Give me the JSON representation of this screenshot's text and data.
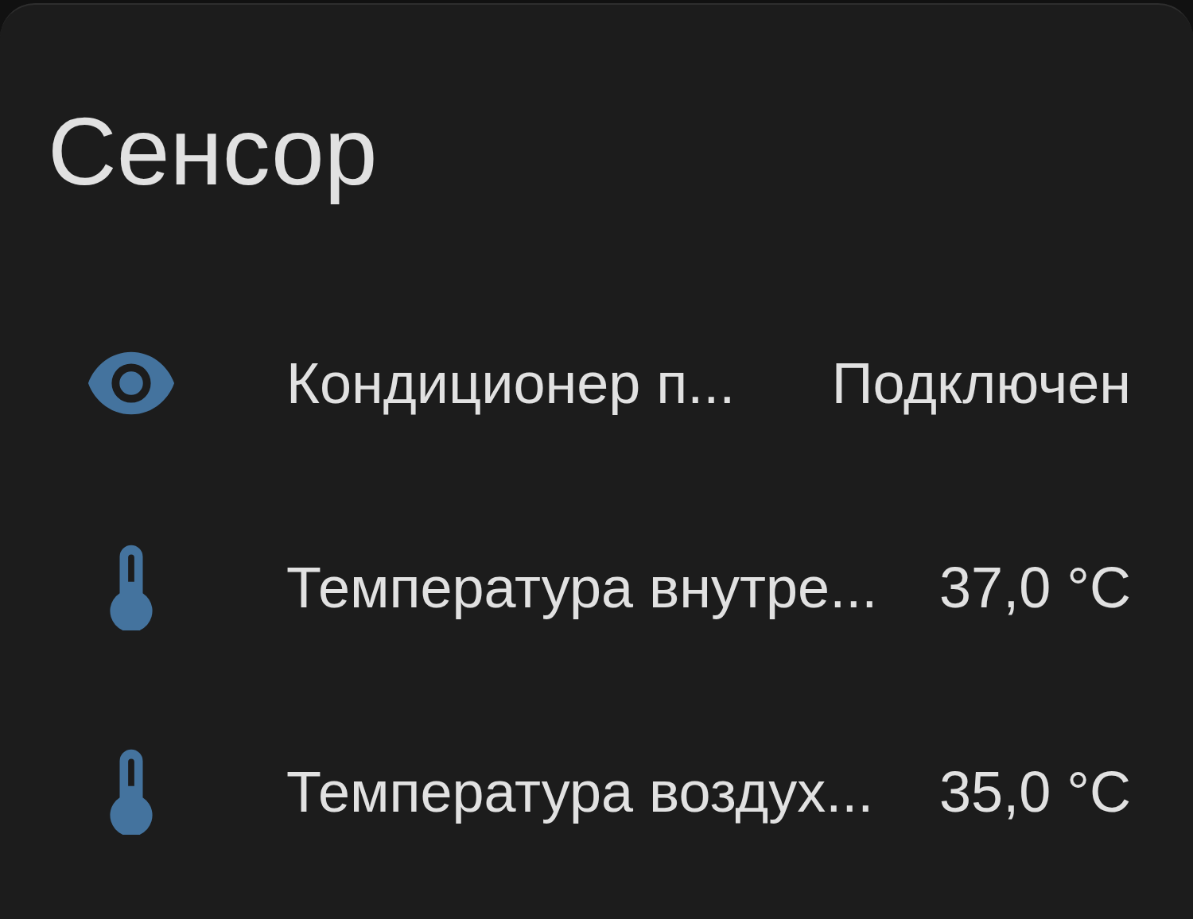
{
  "card": {
    "title": "Сенсор",
    "entities": [
      {
        "kind": "connectivity",
        "name": "Кондиционер п...",
        "state": "Подключен"
      },
      {
        "kind": "temperature",
        "name": "Температура внутре...",
        "state": "37,0 °C"
      },
      {
        "kind": "temperature",
        "name": "Температура воздух...",
        "state": "35,0 °C"
      }
    ]
  }
}
